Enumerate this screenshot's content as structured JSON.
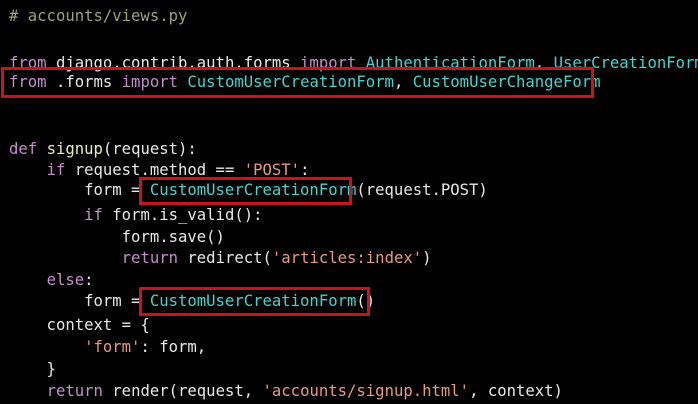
{
  "editor": {
    "background": "#000000",
    "colors": {
      "comment": "#97a37c",
      "keyword": "#c58ecb",
      "class": "#43d5d0",
      "string": "#ea9a7d",
      "func": "#ecebc0",
      "plain": "#e8e8e8",
      "highlight_box": "#c8141c"
    },
    "lines": [
      {
        "tokens": [
          {
            "t": "comment",
            "v": "# accounts/views.py"
          }
        ]
      },
      {
        "tokens": []
      },
      {
        "tokens": [
          {
            "t": "keyword",
            "v": "from"
          },
          {
            "t": "plain",
            "v": " django.contrib.auth.forms "
          },
          {
            "t": "keyword",
            "v": "import"
          },
          {
            "t": "plain",
            "v": " "
          },
          {
            "t": "class",
            "v": "AuthenticationForm"
          },
          {
            "t": "plain",
            "v": ", "
          },
          {
            "t": "class",
            "v": "UserCreationForm"
          }
        ]
      },
      {
        "tokens": [
          {
            "t": "keyword",
            "v": "from"
          },
          {
            "t": "plain",
            "v": " .forms "
          },
          {
            "t": "keyword",
            "v": "import"
          },
          {
            "t": "plain",
            "v": " "
          },
          {
            "t": "class",
            "v": "CustomUserCreationForm"
          },
          {
            "t": "plain",
            "v": ", "
          },
          {
            "t": "class",
            "v": "CustomUserChangeForm"
          }
        ]
      },
      {
        "tokens": []
      },
      {
        "tokens": []
      },
      {
        "tokens": [
          {
            "t": "keyword",
            "v": "def"
          },
          {
            "t": "plain",
            "v": " "
          },
          {
            "t": "func",
            "v": "signup"
          },
          {
            "t": "plain",
            "v": "(request):"
          }
        ]
      },
      {
        "tokens": [
          {
            "t": "plain",
            "v": "    "
          },
          {
            "t": "keyword",
            "v": "if"
          },
          {
            "t": "plain",
            "v": " request.method == "
          },
          {
            "t": "string",
            "v": "'POST'"
          },
          {
            "t": "plain",
            "v": ":"
          }
        ]
      },
      {
        "tokens": [
          {
            "t": "plain",
            "v": "        form = "
          },
          {
            "t": "class",
            "v": "CustomUserCreationForm"
          },
          {
            "t": "plain",
            "v": "(request.POST)"
          }
        ]
      },
      {
        "tokens": [
          {
            "t": "plain",
            "v": "        "
          },
          {
            "t": "keyword",
            "v": "if"
          },
          {
            "t": "plain",
            "v": " form.is_valid():"
          }
        ]
      },
      {
        "tokens": [
          {
            "t": "plain",
            "v": "            form.save()"
          }
        ]
      },
      {
        "tokens": [
          {
            "t": "plain",
            "v": "            "
          },
          {
            "t": "keyword",
            "v": "return"
          },
          {
            "t": "plain",
            "v": " redirect("
          },
          {
            "t": "string",
            "v": "'articles:index'"
          },
          {
            "t": "plain",
            "v": ")"
          }
        ]
      },
      {
        "tokens": [
          {
            "t": "plain",
            "v": "    "
          },
          {
            "t": "keyword",
            "v": "else"
          },
          {
            "t": "plain",
            "v": ":"
          }
        ]
      },
      {
        "tokens": [
          {
            "t": "plain",
            "v": "        form = "
          },
          {
            "t": "class",
            "v": "CustomUserCreationForm"
          },
          {
            "t": "plain",
            "v": "()"
          }
        ]
      },
      {
        "tokens": [
          {
            "t": "plain",
            "v": "    context = {"
          }
        ]
      },
      {
        "tokens": [
          {
            "t": "plain",
            "v": "        "
          },
          {
            "t": "string",
            "v": "'form'"
          },
          {
            "t": "plain",
            "v": ": form,"
          }
        ]
      },
      {
        "tokens": [
          {
            "t": "plain",
            "v": "    }"
          }
        ]
      },
      {
        "tokens": [
          {
            "t": "plain",
            "v": "    "
          },
          {
            "t": "keyword",
            "v": "return"
          },
          {
            "t": "plain",
            "v": " render(request, "
          },
          {
            "t": "string",
            "v": "'accounts/signup.html'"
          },
          {
            "t": "plain",
            "v": ", context)"
          }
        ]
      }
    ]
  }
}
